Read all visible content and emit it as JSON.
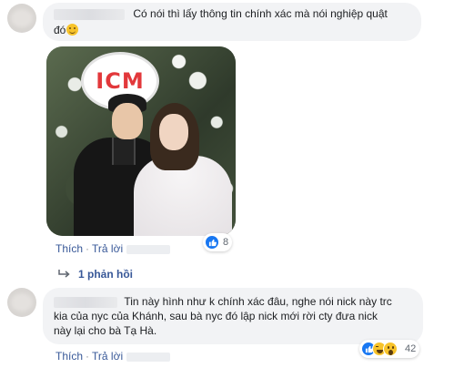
{
  "comment1": {
    "text_line1": "Có nói thì lấy thông tin chính xác mà nói nghiệp quật",
    "text_line2": "đó",
    "emoji": "smile-emoji"
  },
  "photo": {
    "sign_text": "ICM",
    "reaction_count": "8"
  },
  "actions1": {
    "like": "Thích",
    "reply": "Trả lời"
  },
  "replies": {
    "label": "1 phản hồi"
  },
  "comment2": {
    "line1": "Tin này hình như k chính xác đâu, nghe nói nick này trc",
    "line2": "kia của nyc của Khánh, sau bà nyc đó lập nick mới rời cty đưa nick",
    "line3": "này lại cho bà Tạ Hà.",
    "reaction_count": "42"
  },
  "actions2": {
    "like": "Thích",
    "reply": "Trả lời"
  },
  "colors": {
    "link": "#385898",
    "bubble": "#f2f3f5",
    "like_blue": "#1877f2"
  }
}
